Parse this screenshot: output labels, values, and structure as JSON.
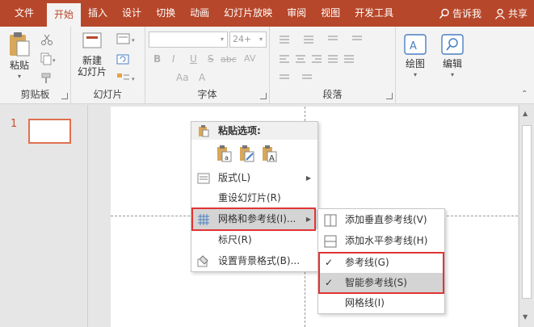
{
  "tabs": [
    "文件",
    "开始",
    "插入",
    "设计",
    "切换",
    "动画",
    "幻灯片放映",
    "审阅",
    "视图",
    "开发工具"
  ],
  "active_tab": "开始",
  "tell_me": "告诉我",
  "share": "共享",
  "ribbon": {
    "clipboard": {
      "paste": "粘贴",
      "label": "剪贴板"
    },
    "slides": {
      "new_slide_line1": "新建",
      "new_slide_line2": "幻灯片",
      "label": "幻灯片"
    },
    "font": {
      "font_size": "24+",
      "label": "字体",
      "buttons": [
        "B",
        "I",
        "U",
        "S",
        "abc",
        "AV",
        "Aa",
        "A"
      ]
    },
    "paragraph": {
      "label": "段落"
    },
    "drawing": {
      "label": "绘图"
    },
    "editing": {
      "label": "编辑"
    }
  },
  "slide_pane": {
    "slide_number": "1"
  },
  "context_menu": {
    "paste_options_title": "粘贴选项:",
    "items": [
      {
        "label": "版式(L)",
        "has_submenu": true
      },
      {
        "label": "重设幻灯片(R)",
        "has_submenu": false
      },
      {
        "label": "网格和参考线(I)...",
        "has_submenu": true,
        "highlighted": true
      },
      {
        "label": "标尺(R)",
        "has_submenu": false
      },
      {
        "label": "设置背景格式(B)...",
        "has_submenu": false
      }
    ]
  },
  "submenu": {
    "items": [
      {
        "label": "添加垂直参考线(V)",
        "checked": false
      },
      {
        "label": "添加水平参考线(H)",
        "checked": false
      },
      {
        "label": "参考线(G)",
        "checked": true
      },
      {
        "label": "智能参考线(S)",
        "checked": true,
        "highlighted": true
      },
      {
        "label": "网格线(I)",
        "checked": false
      }
    ]
  },
  "colors": {
    "accent": "#b7472a",
    "highlight_box": "#e03535"
  }
}
